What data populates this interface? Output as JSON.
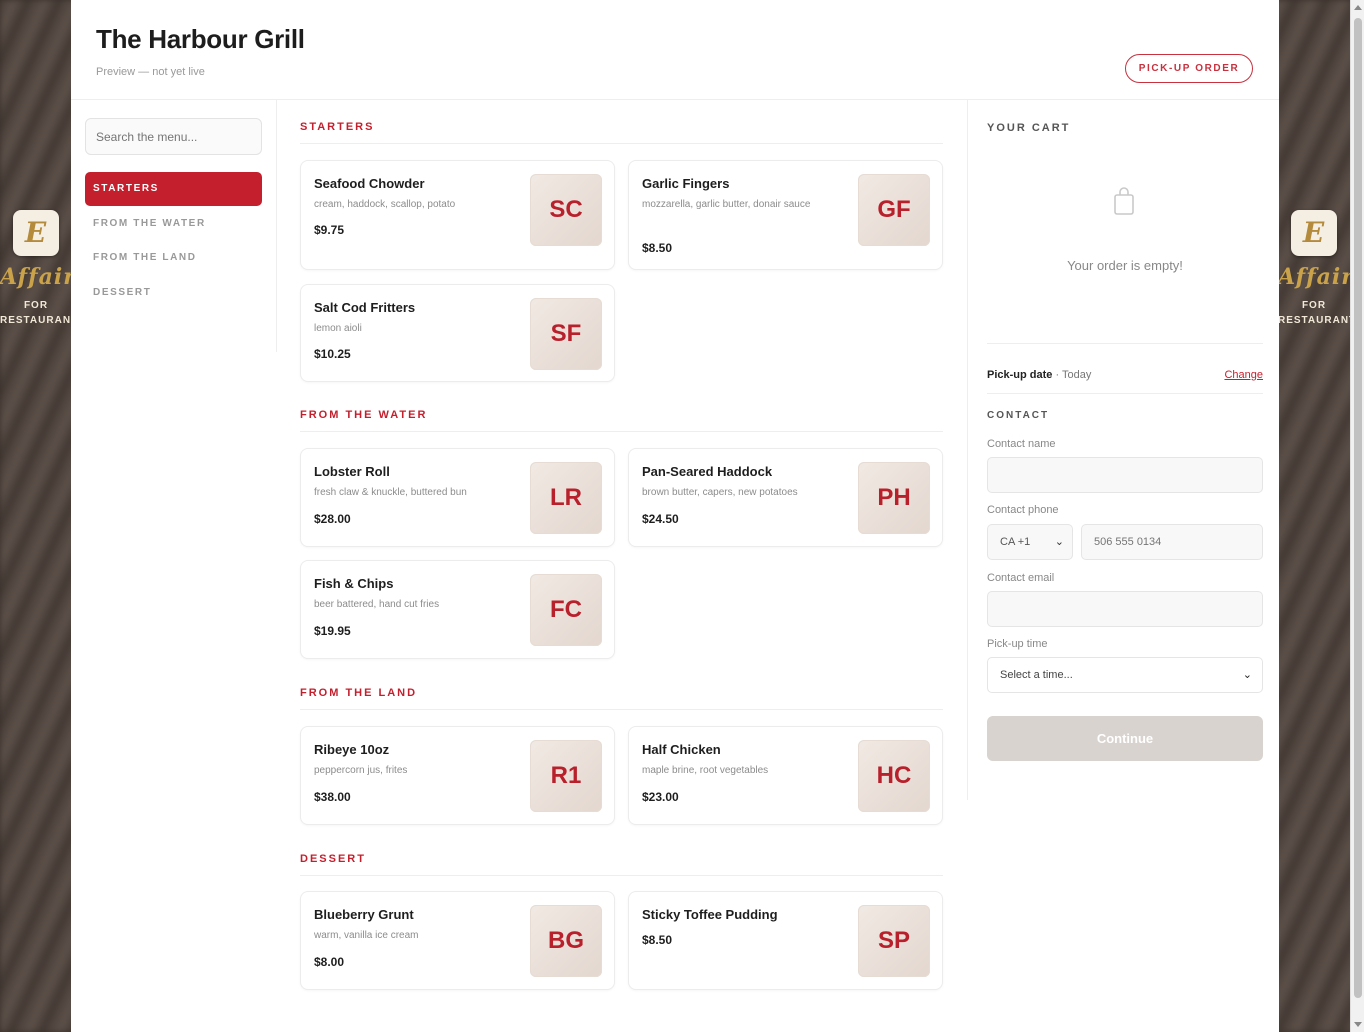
{
  "background": {
    "brand_letter": "E",
    "brand_script": "Affair",
    "brand_caption_lines": [
      "FOR",
      "RESTAURANTS"
    ]
  },
  "header": {
    "title": "The Harbour Grill",
    "subtitle": "Preview — not yet live",
    "order_mode_button": "PICK-UP ORDER"
  },
  "sidebar": {
    "search_placeholder": "Search the menu...",
    "categories": [
      {
        "label": "STARTERS",
        "active": true
      },
      {
        "label": "FROM THE WATER",
        "active": false
      },
      {
        "label": "FROM THE LAND",
        "active": false
      },
      {
        "label": "DESSERT",
        "active": false
      }
    ]
  },
  "menu": {
    "sections": [
      {
        "title": "STARTERS",
        "items": [
          {
            "name": "Seafood Chowder",
            "description": "cream, haddock, scallop, potato",
            "price": "$9.75",
            "initials": "SC"
          },
          {
            "name": "Garlic Fingers",
            "description": "mozzarella, garlic butter, donair sauce",
            "price": "$8.50",
            "initials": "GF"
          },
          {
            "name": "Salt Cod Fritters",
            "description": "lemon aioli",
            "price": "$10.25",
            "initials": "SF"
          }
        ]
      },
      {
        "title": "FROM THE WATER",
        "items": [
          {
            "name": "Lobster Roll",
            "description": "fresh claw & knuckle, buttered bun",
            "price": "$28.00",
            "initials": "LR"
          },
          {
            "name": "Pan-Seared Haddock",
            "description": "brown butter, capers, new potatoes",
            "price": "$24.50",
            "initials": "PH"
          },
          {
            "name": "Fish & Chips",
            "description": "beer battered, hand cut fries",
            "price": "$19.95",
            "initials": "FC"
          }
        ]
      },
      {
        "title": "FROM THE LAND",
        "items": [
          {
            "name": "Ribeye 10oz",
            "description": "peppercorn jus, frites",
            "price": "$38.00",
            "initials": "R1"
          },
          {
            "name": "Half Chicken",
            "description": "maple brine, root vegetables",
            "price": "$23.00",
            "initials": "HC"
          }
        ]
      },
      {
        "title": "DESSERT",
        "items": [
          {
            "name": "Blueberry Grunt",
            "description": "warm, vanilla ice cream",
            "price": "$8.00",
            "initials": "BG"
          },
          {
            "name": "Sticky Toffee Pudding",
            "description": "",
            "price": "$8.50",
            "initials": "SP"
          }
        ]
      }
    ]
  },
  "cart": {
    "title": "YOUR CART",
    "empty_message": "Your order is empty!",
    "pickup_date_label": "Pick-up date",
    "pickup_date_value": "· Today",
    "change_link": "Change",
    "contact_title": "CONTACT",
    "contact_name_label": "Contact name",
    "contact_phone_label": "Contact phone",
    "phone_country": "CA +1",
    "phone_placeholder": "506 555 0134",
    "contact_email_label": "Contact email",
    "pickup_time_label": "Pick-up time",
    "pickup_time_placeholder": "Select a time...",
    "continue_button": "Continue"
  },
  "colors": {
    "accent": "#c41f2d",
    "disabled_button": "#d8d3ce"
  }
}
